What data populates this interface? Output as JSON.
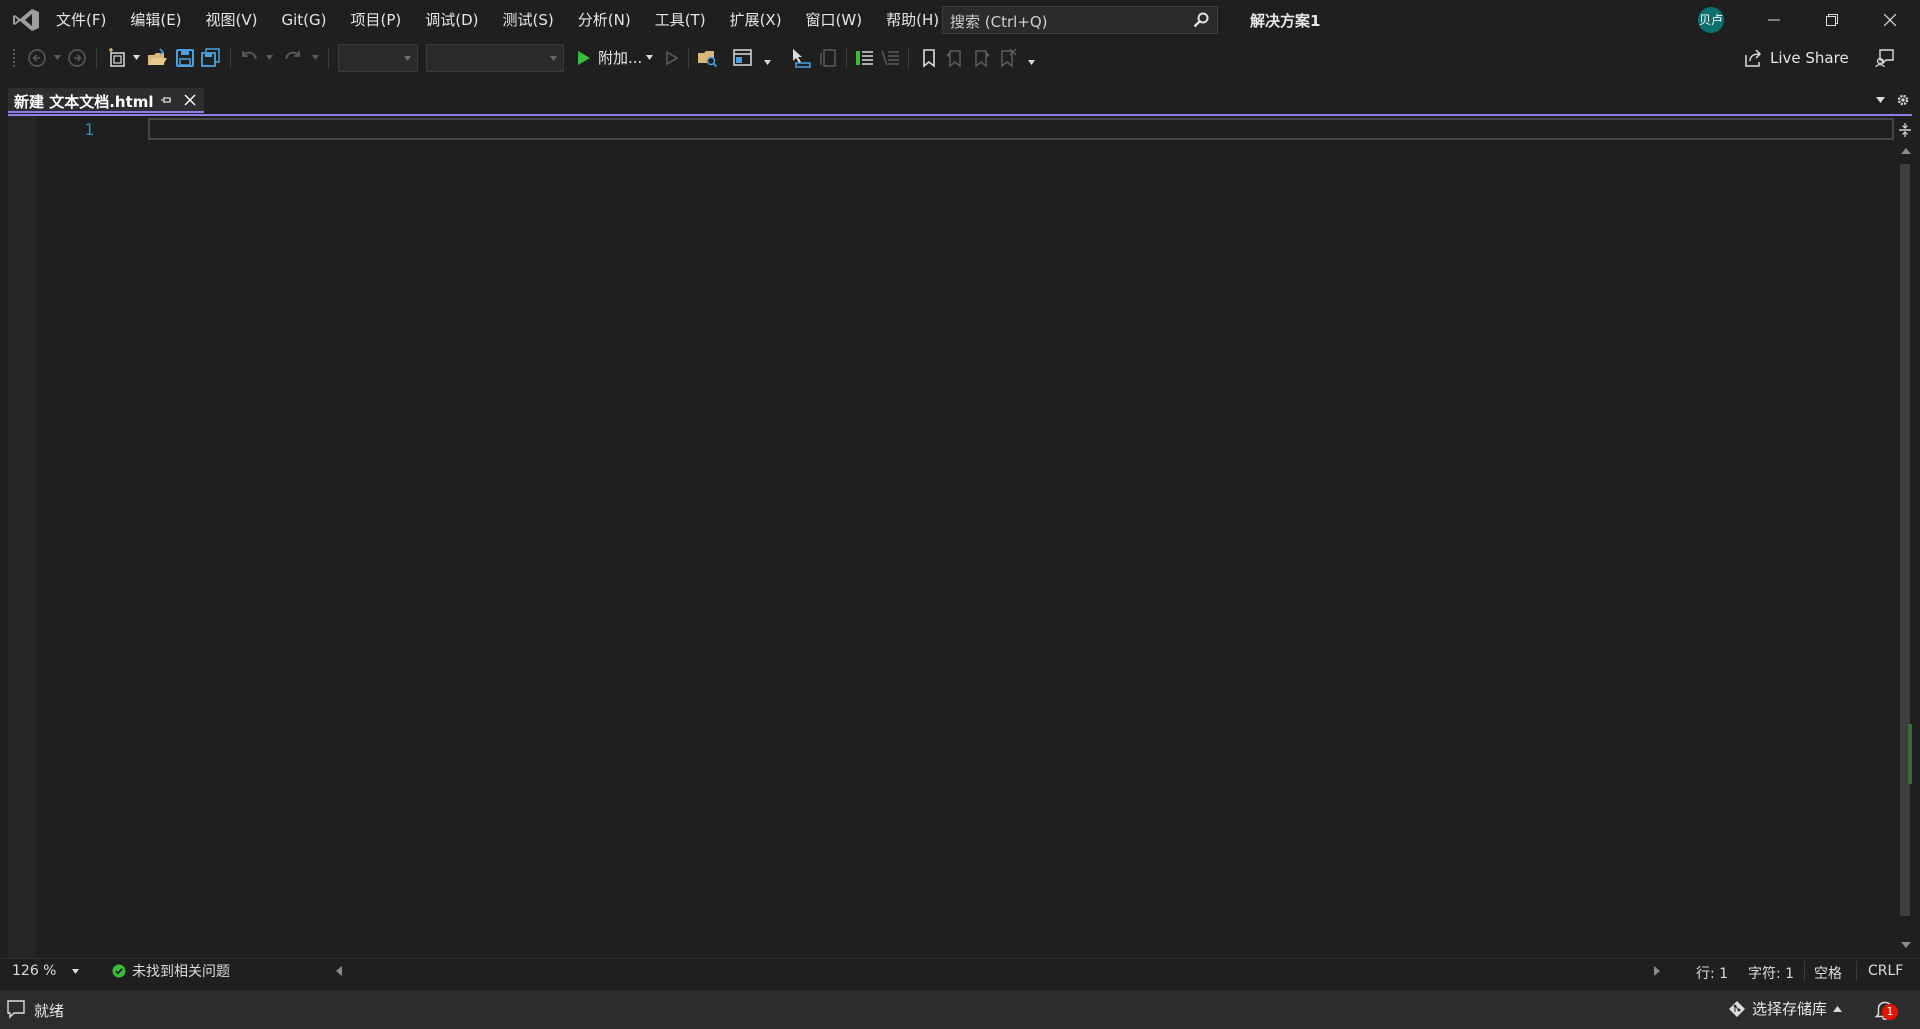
{
  "menu": {
    "items": [
      "文件(F)",
      "编辑(E)",
      "视图(V)",
      "Git(G)",
      "项目(P)",
      "调试(D)",
      "测试(S)",
      "分析(N)",
      "工具(T)",
      "扩展(X)",
      "窗口(W)",
      "帮助(H)"
    ]
  },
  "search": {
    "placeholder": "搜索 (Ctrl+Q)"
  },
  "solution_name": "解决方案1",
  "user": {
    "avatar_text": "贝卢"
  },
  "toolbar": {
    "start_label": "附加...",
    "config_value": "",
    "platform_value": "",
    "live_share_label": "Live Share"
  },
  "tab": {
    "title": "新建 文本文档.html"
  },
  "editor": {
    "line_numbers": [
      "1"
    ],
    "content": ""
  },
  "editor_status": {
    "zoom": "126 %",
    "issues": "未找到相关问题",
    "line": "行: 1",
    "char": "字符: 1",
    "indent": "空格",
    "line_ending": "CRLF"
  },
  "status": {
    "text": "就绪",
    "repo_label": "选择存储库",
    "notification_count": "1"
  },
  "colors": {
    "background": "#1f1f1f",
    "accent": "#8a80e8",
    "line_number": "#2b91af",
    "run_green": "#3cbc3c",
    "save_blue": "#4ca0e0",
    "folder_yellow": "#dcb67a",
    "badge_red": "#e51400"
  }
}
